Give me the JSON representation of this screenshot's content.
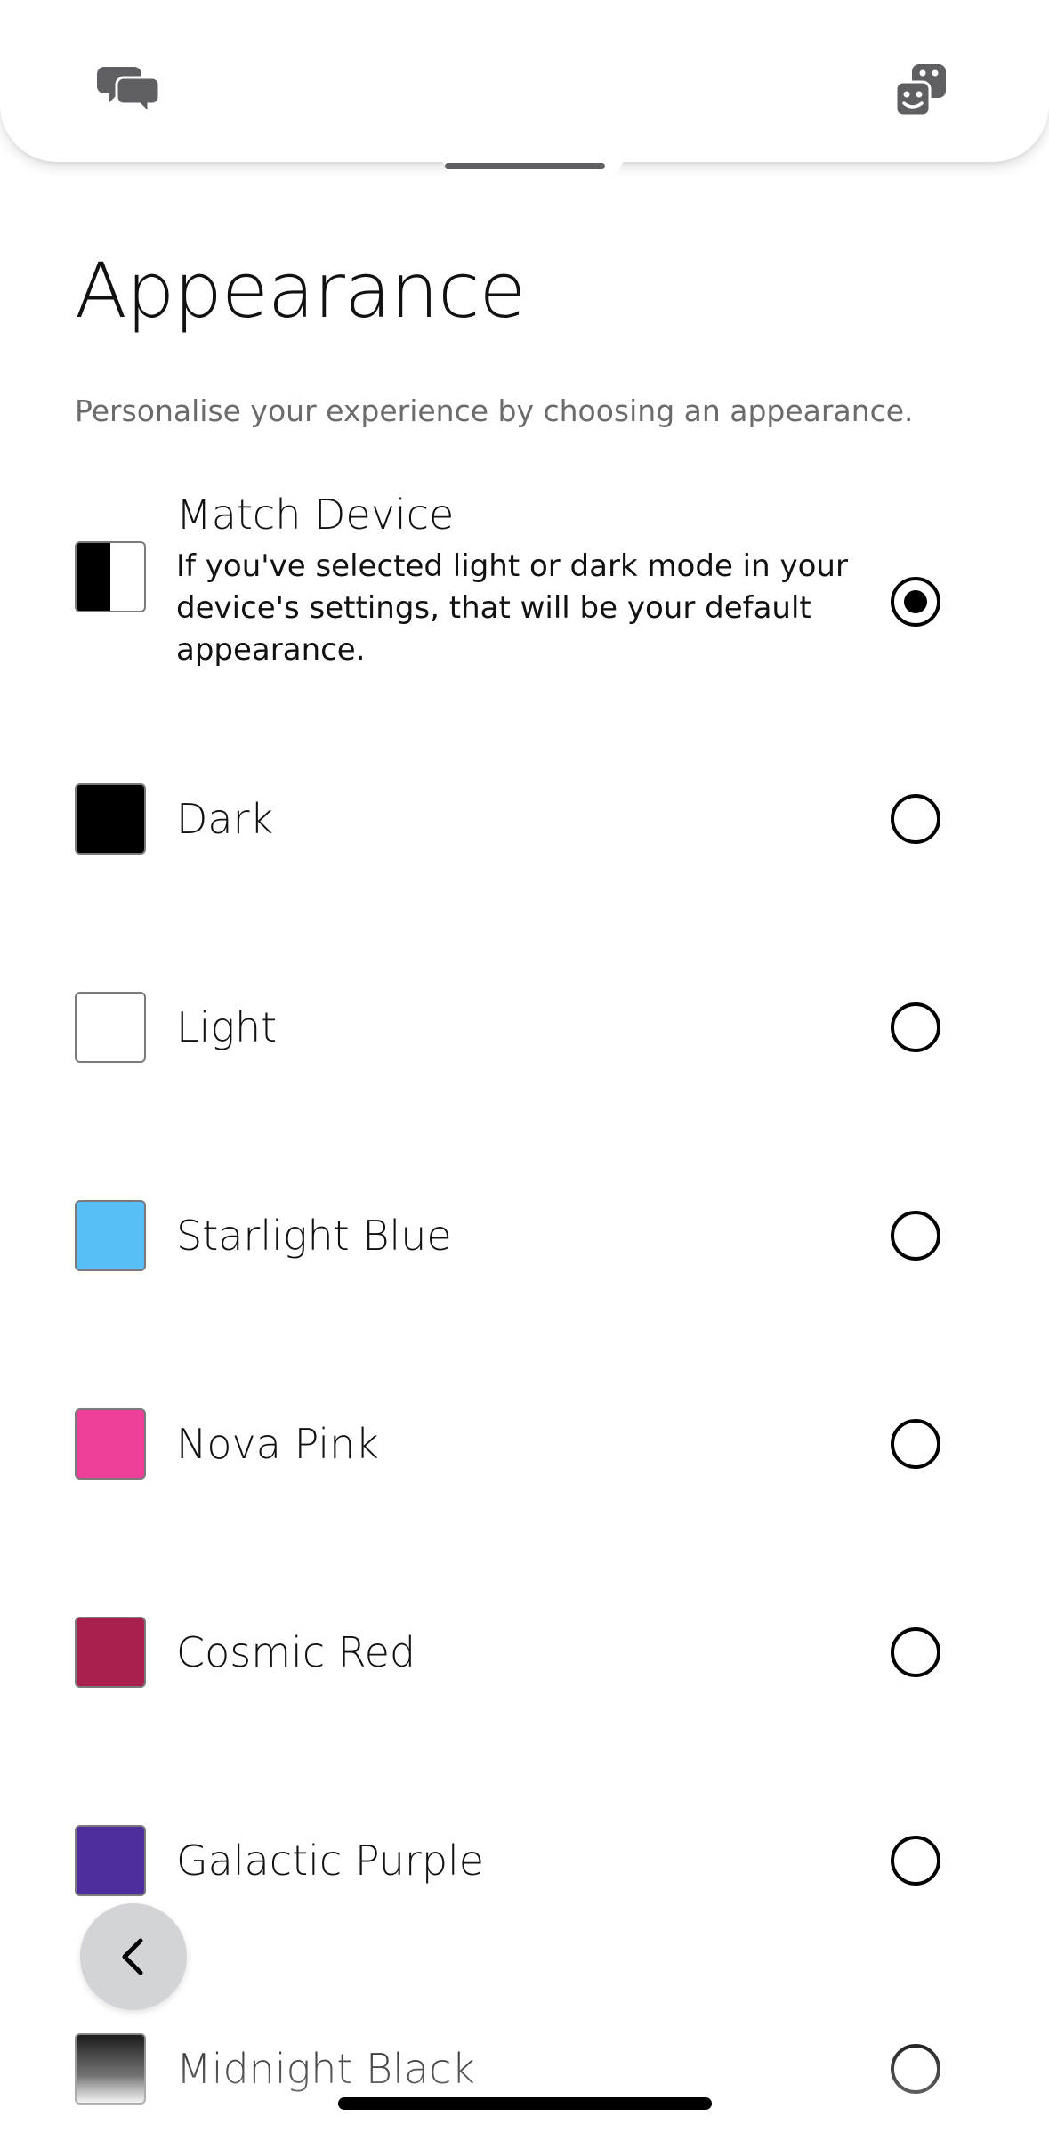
{
  "header": {
    "left_icon": "chat-bubbles-icon",
    "right_icon": "game-pieces-icon"
  },
  "page": {
    "title": "Appearance",
    "description": "Personalise your experience by choosing an appearance."
  },
  "options": [
    {
      "label": "Match Device",
      "sublabel": "If you've selected light or dark mode in your device's settings, that will be your default appearance.",
      "swatch": "split",
      "color": "#000000",
      "selected": true
    },
    {
      "label": "Dark",
      "swatch": "solid",
      "color": "#000000",
      "selected": false
    },
    {
      "label": "Light",
      "swatch": "solid",
      "color": "#ffffff",
      "selected": false
    },
    {
      "label": "Starlight Blue",
      "swatch": "solid",
      "color": "#57bff7",
      "selected": false
    },
    {
      "label": "Nova Pink",
      "swatch": "solid",
      "color": "#ee3f98",
      "selected": false
    },
    {
      "label": "Cosmic Red",
      "swatch": "solid",
      "color": "#a91f4e",
      "selected": false
    },
    {
      "label": "Galactic Purple",
      "swatch": "solid",
      "color": "#4e2d9c",
      "selected": false
    },
    {
      "label": "Midnight Black",
      "swatch": "gradient",
      "color": "#000000",
      "selected": false
    }
  ],
  "back_button": {
    "icon": "chevron-left-icon"
  }
}
